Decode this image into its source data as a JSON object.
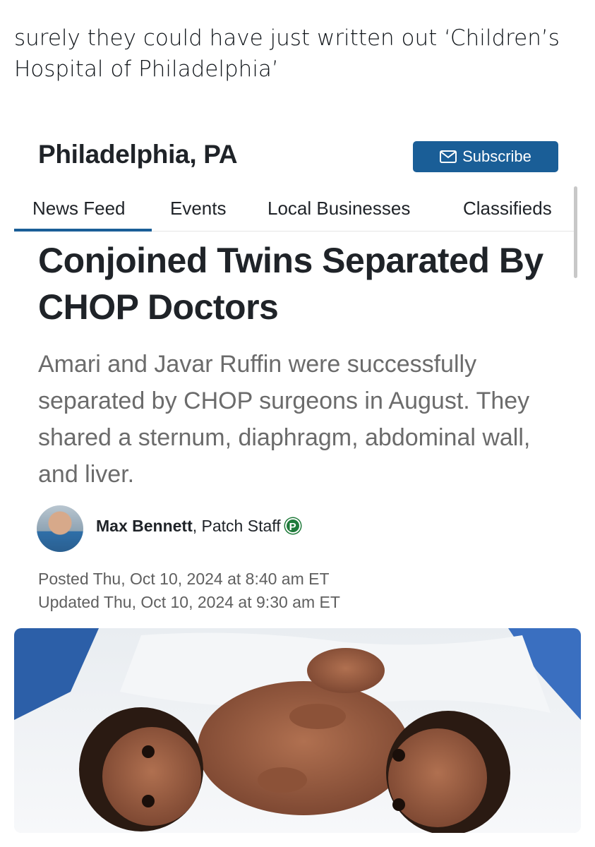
{
  "tweet": {
    "text": "surely they could have just written out ‘Children’s Hospital of Philadelphia’"
  },
  "site": {
    "title": "Philadelphia, PA",
    "subscribe_label": "Subscribe",
    "accent_color": "#1a5e97"
  },
  "nav": {
    "items": [
      {
        "label": "News Feed",
        "active": true
      },
      {
        "label": "Events",
        "active": false
      },
      {
        "label": "Local Businesses",
        "active": false
      },
      {
        "label": "Classifieds",
        "active": false
      }
    ]
  },
  "article": {
    "headline": "Conjoined Twins Separated By CHOP Doctors",
    "summary": "Amari and Javar Ruffin were successfully separated by CHOP surgeons in August. They shared a sternum, diaphragm, abdominal wall, and liver.",
    "author_name": "Max Bennett",
    "author_role": ", Patch Staff",
    "badge_letter": "P",
    "posted": "Posted Thu, Oct 10, 2024 at 8:40 am ET",
    "updated": "Updated Thu, Oct 10, 2024 at 9:30 am ET"
  },
  "icons": {
    "subscribe": "envelope-icon",
    "badge": "patch-badge-icon"
  }
}
